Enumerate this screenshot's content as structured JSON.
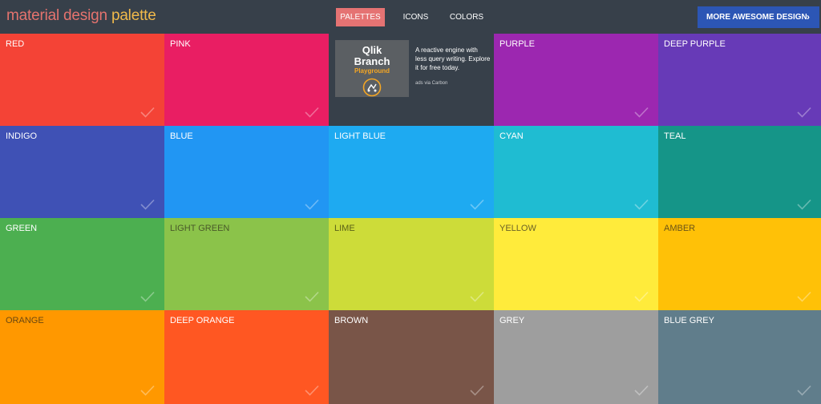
{
  "header": {
    "brand_part1": "material design",
    "brand_part2": "palette",
    "nav": [
      {
        "label": "PALETTES",
        "active": true
      },
      {
        "label": "ICONS",
        "active": false
      },
      {
        "label": "COLORS",
        "active": false
      }
    ],
    "cta_label": "MORE AWESOME DESIGN",
    "cta_icon": "chevron-right-icon",
    "cta_glyph": "›"
  },
  "ad": {
    "logo_line1": "Qlik",
    "logo_line2": "Branch",
    "logo_line3": "Playground",
    "text": "A reactive engine with less query writing. Explore it for free today.",
    "via": "ads via Carbon"
  },
  "colors": [
    {
      "label": "RED",
      "bg": "#f44336",
      "text": "#ffffff"
    },
    {
      "label": "PINK",
      "bg": "#e91e63",
      "text": "#ffffff"
    },
    {
      "label": "PURPLE",
      "bg": "#9c27b0",
      "text": "#ffffff"
    },
    {
      "label": "DEEP PURPLE",
      "bg": "#673ab7",
      "text": "#ffffff"
    },
    {
      "label": "INDIGO",
      "bg": "#3f51b5",
      "text": "#ffffff"
    },
    {
      "label": "BLUE",
      "bg": "#2196f3",
      "text": "#ffffff"
    },
    {
      "label": "LIGHT BLUE",
      "bg": "#1eaaf1",
      "text": "#ffffff"
    },
    {
      "label": "CYAN",
      "bg": "#1fbcd2",
      "text": "#ffffff"
    },
    {
      "label": "TEAL",
      "bg": "#159588",
      "text": "#ffffff"
    },
    {
      "label": "GREEN",
      "bg": "#4caf50",
      "text": "#ffffff"
    },
    {
      "label": "LIGHT GREEN",
      "bg": "#8bc34a",
      "text": "#4a5a2a"
    },
    {
      "label": "LIME",
      "bg": "#cddc39",
      "text": "#5a6118"
    },
    {
      "label": "YELLOW",
      "bg": "#ffeb3b",
      "text": "#6b6228"
    },
    {
      "label": "AMBER",
      "bg": "#ffc107",
      "text": "#6b5418"
    },
    {
      "label": "ORANGE",
      "bg": "#ff9800",
      "text": "#6b4810"
    },
    {
      "label": "DEEP ORANGE",
      "bg": "#ff5722",
      "text": "#ffffff"
    },
    {
      "label": "BROWN",
      "bg": "#795548",
      "text": "#ffffff"
    },
    {
      "label": "GREY",
      "bg": "#9e9e9e",
      "text": "#ffffff"
    },
    {
      "label": "BLUE GREY",
      "bg": "#607d8b",
      "text": "#ffffff"
    }
  ]
}
